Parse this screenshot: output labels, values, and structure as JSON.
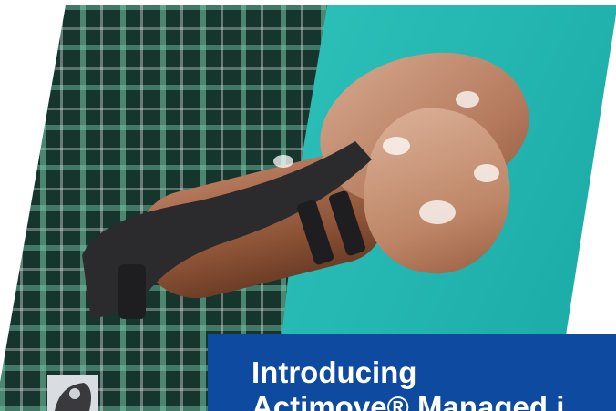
{
  "banner": {
    "line1": "Introducing",
    "line2": "Actimove® Managed i"
  },
  "colors": {
    "banner_bg": "#0d4aa0",
    "background_teal": "#2bbfb8",
    "shirt_dark": "#16352c",
    "brace": "#2b2b2e"
  },
  "image": {
    "alt": "Person washing hands while wearing a black wrist brace"
  }
}
